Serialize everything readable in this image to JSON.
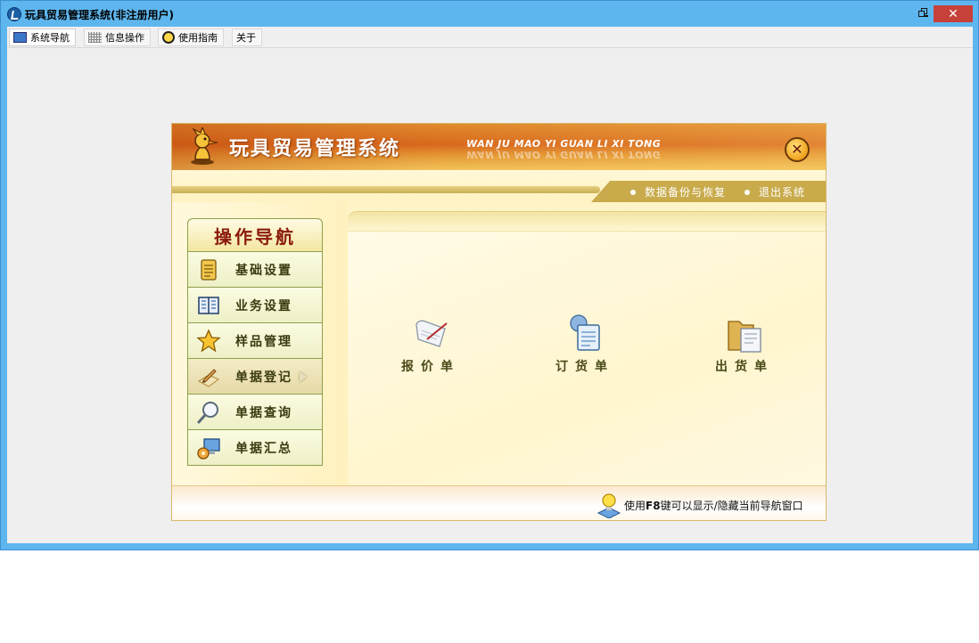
{
  "window": {
    "title": "玩具贸易管理系统(非注册用户)",
    "close_glyph": "✕"
  },
  "menubar": {
    "items": [
      {
        "label": "系统导航",
        "icon": "monitor-icon"
      },
      {
        "label": "信息操作",
        "icon": "grid-icon"
      },
      {
        "label": "使用指南",
        "icon": "help-icon"
      },
      {
        "label": "关于",
        "icon": ""
      }
    ]
  },
  "banner": {
    "title": "玩具贸易管理系统",
    "subtitle": "WAN JU MAO YI GUAN LI XI TONG",
    "close_glyph": "✕"
  },
  "subbar": {
    "links": [
      "数据备份与恢复",
      "退出系统"
    ]
  },
  "nav": {
    "header": "操作导航",
    "items": [
      {
        "label": "基础设置",
        "icon": "ledger-icon"
      },
      {
        "label": "业务设置",
        "icon": "book-icon"
      },
      {
        "label": "样品管理",
        "icon": "star-icon"
      },
      {
        "label": "单据登记",
        "icon": "pencil-icon",
        "active": true
      },
      {
        "label": "单据查询",
        "icon": "magnifier-icon"
      },
      {
        "label": "单据汇总",
        "icon": "computer-gear-icon"
      }
    ]
  },
  "documents": [
    {
      "label": "报价单",
      "icon": "scroll-icon"
    },
    {
      "label": "订货单",
      "icon": "clipboard-gear-icon"
    },
    {
      "label": "出货单",
      "icon": "folder-doc-icon"
    }
  ],
  "footer": {
    "prefix": "使用",
    "key": "F8",
    "suffix": "键可以显示/隐藏当前导航窗口"
  },
  "colors": {
    "titlebar": "#5eb6ee",
    "close": "#c7403a",
    "banner": "#d8681d",
    "nav_text": "#8a1a0a"
  }
}
